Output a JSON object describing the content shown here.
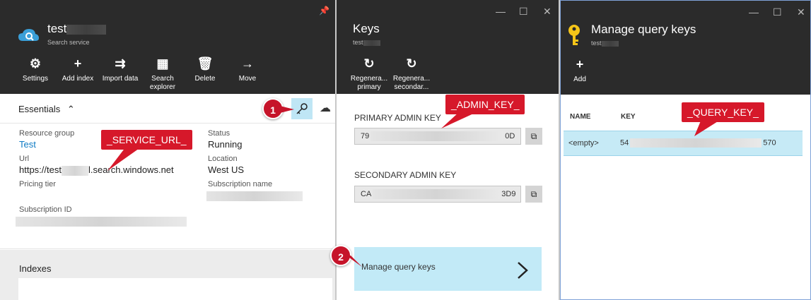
{
  "blade_service": {
    "title": "test",
    "subtitle": "Search service",
    "tools": [
      {
        "icon": "gear-icon",
        "glyph": "⚙",
        "label": "Settings"
      },
      {
        "icon": "plus-icon",
        "glyph": "+",
        "label": "Add index"
      },
      {
        "icon": "import-icon",
        "glyph": "⇉",
        "label": "Import data"
      },
      {
        "icon": "search-explorer-icon",
        "glyph": "▦",
        "label": "Search explorer"
      },
      {
        "icon": "trash-icon",
        "glyph": "🗑",
        "label": "Delete"
      },
      {
        "icon": "arrow-right-icon",
        "glyph": "→",
        "label": "Move"
      }
    ],
    "essentials": {
      "title": "Essentials",
      "resource_group_label": "Resource group",
      "resource_group_value": "Test",
      "url_label": "Url",
      "url_prefix": "https://test",
      "url_suffix": "l.search.windows.net",
      "pricing_tier_label": "Pricing tier",
      "subscription_id_label": "Subscription ID",
      "status_label": "Status",
      "status_value": "Running",
      "location_label": "Location",
      "location_value": "West US",
      "subscription_name_label": "Subscription name"
    },
    "indexes_title": "Indexes"
  },
  "blade_keys": {
    "title": "Keys",
    "subtitle": "test",
    "tools": [
      {
        "icon": "refresh-icon",
        "glyph": "↻",
        "label": "Regenera... primary"
      },
      {
        "icon": "refresh-icon",
        "glyph": "↻",
        "label": "Regenera... secondar..."
      }
    ],
    "primary_label": "PRIMARY ADMIN KEY",
    "primary_start": "79",
    "primary_end": "0D",
    "secondary_label": "SECONDARY ADMIN KEY",
    "secondary_start": "CA",
    "secondary_end": "3D9",
    "manage_label": "Manage query keys"
  },
  "blade_query": {
    "title": "Manage query keys",
    "subtitle": "test",
    "tools": [
      {
        "icon": "plus-icon",
        "glyph": "+",
        "label": "Add"
      }
    ],
    "col_name": "NAME",
    "col_key": "KEY",
    "row_name": "<empty>",
    "row_key_start": "54",
    "row_key_end": "570"
  },
  "callouts": {
    "service_url": "_SERVICE_URL_",
    "admin_key": "_ADMIN_KEY_",
    "query_key": "_QUERY_KEY_",
    "step1": "1",
    "step2": "2"
  },
  "window_controls": {
    "minimize": "—",
    "maximize": "☐",
    "close": "✕"
  },
  "colors": {
    "header_bg": "#2b2b2b",
    "accent": "#0f7bc4",
    "callout_red": "#d6182a",
    "tile_blue": "#c2eaf7"
  }
}
